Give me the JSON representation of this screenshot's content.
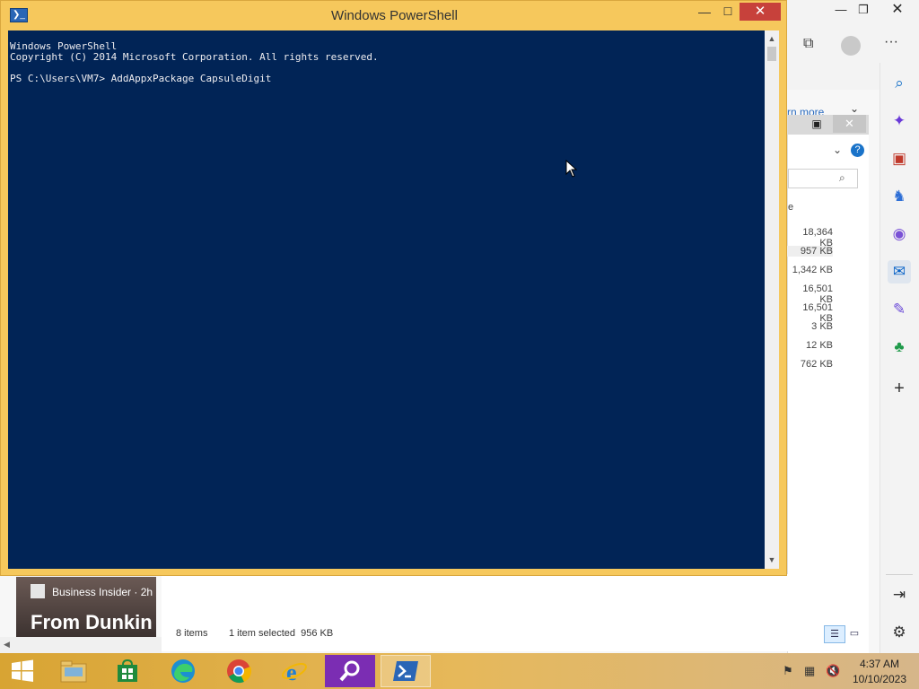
{
  "powershell": {
    "title": "Windows PowerShell",
    "console_lines": [
      "Windows PowerShell",
      "Copyright (C) 2014 Microsoft Corporation. All rights reserved.",
      "",
      "PS C:\\Users\\VM7> AddAppxPackage CapsuleDigit"
    ],
    "background_color": "#012456",
    "text_color": "#eeedf0",
    "frame_color": "#f6c85c"
  },
  "edge": {
    "learn_more_partial": "rn more"
  },
  "explorer": {
    "column_partial": "e",
    "file_sizes": [
      "18,364 KB",
      "957 KB",
      "1,342 KB",
      "16,501 KB",
      "16,501 KB",
      "3 KB",
      "12 KB",
      "762 KB"
    ],
    "status_items": "8 items",
    "status_selected": "1 item selected  956 KB"
  },
  "news": {
    "source": "Business Insider · 2h",
    "headline": "From Dunkin"
  },
  "taskbar": {
    "time": "4:37 AM",
    "date": "10/10/2023",
    "apps": [
      "start",
      "file-explorer",
      "store",
      "edge",
      "chrome",
      "internet-explorer",
      "search-app",
      "powershell"
    ]
  }
}
